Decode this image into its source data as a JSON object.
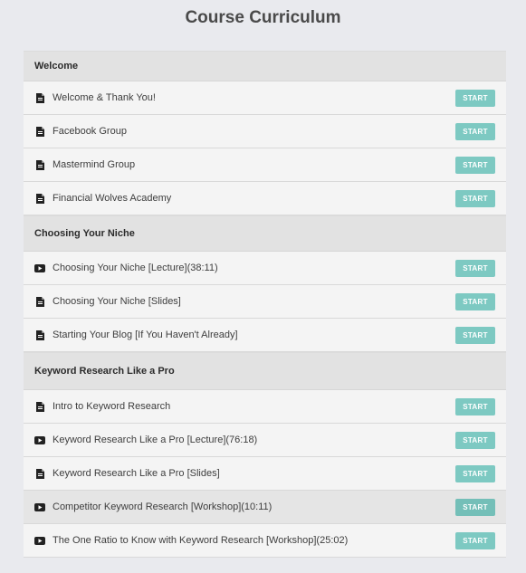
{
  "page": {
    "title": "Course Curriculum"
  },
  "sections": [
    {
      "title": "Welcome",
      "items": [
        {
          "label": "Welcome & Thank You!",
          "icon": "document-icon",
          "button": "START"
        },
        {
          "label": "Facebook Group",
          "icon": "document-icon",
          "button": "START"
        },
        {
          "label": "Mastermind Group",
          "icon": "document-icon",
          "button": "START"
        },
        {
          "label": "Financial Wolves Academy",
          "icon": "document-icon",
          "button": "START"
        }
      ]
    },
    {
      "title": "Choosing Your Niche",
      "items": [
        {
          "label": "Choosing Your Niche [Lecture](38:11)",
          "icon": "video-icon",
          "button": "START"
        },
        {
          "label": "Choosing Your Niche [Slides]",
          "icon": "document-icon",
          "button": "START"
        },
        {
          "label": "Starting Your Blog [If You Haven't Already]",
          "icon": "document-icon",
          "button": "START"
        }
      ]
    },
    {
      "title": "Keyword Research Like a Pro",
      "items": [
        {
          "label": "Intro to Keyword Research",
          "icon": "document-icon",
          "button": "START"
        },
        {
          "label": "Keyword Research Like a Pro [Lecture](76:18)",
          "icon": "video-icon",
          "button": "START"
        },
        {
          "label": "Keyword Research Like a Pro [Slides]",
          "icon": "document-icon",
          "button": "START"
        },
        {
          "label": "Competitor Keyword Research [Workshop](10:11)",
          "icon": "video-icon",
          "button": "START"
        },
        {
          "label": "The One Ratio to Know with Keyword Research [Workshop](25:02)",
          "icon": "video-icon",
          "button": "START"
        }
      ]
    }
  ],
  "colors": {
    "accent": "#7dc9c2",
    "background": "#e9eaee"
  }
}
